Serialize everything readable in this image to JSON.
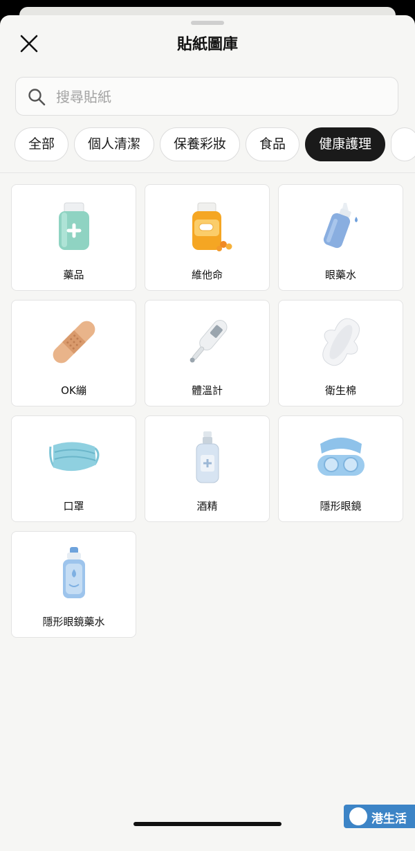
{
  "header": {
    "title": "貼紙圖庫",
    "close_icon": "close-icon"
  },
  "search": {
    "placeholder": "搜尋貼紙",
    "value": "",
    "icon": "search-icon"
  },
  "categories": [
    {
      "label": "全部",
      "active": false
    },
    {
      "label": "個人清潔",
      "active": false
    },
    {
      "label": "保養彩妝",
      "active": false
    },
    {
      "label": "食品",
      "active": false
    },
    {
      "label": "健康護理",
      "active": true
    }
  ],
  "stickers": [
    {
      "label": "藥品",
      "icon": "medicine-bottle-icon"
    },
    {
      "label": "維他命",
      "icon": "vitamin-bottle-icon"
    },
    {
      "label": "眼藥水",
      "icon": "eye-drops-icon"
    },
    {
      "label": "OK繃",
      "icon": "bandage-icon"
    },
    {
      "label": "體溫計",
      "icon": "thermometer-icon"
    },
    {
      "label": "衛生棉",
      "icon": "sanitary-pad-icon"
    },
    {
      "label": "口罩",
      "icon": "face-mask-icon"
    },
    {
      "label": "酒精",
      "icon": "alcohol-spray-icon"
    },
    {
      "label": "隱形眼鏡",
      "icon": "contact-lens-case-icon"
    },
    {
      "label": "隱形眼鏡藥水",
      "icon": "lens-solution-icon"
    }
  ],
  "watermark": {
    "logo": "U",
    "text": "港生活"
  },
  "colors": {
    "sheet_background": "#f6f6f4",
    "active_chip": "#1a1a1a",
    "watermark": "#3c84c6"
  }
}
